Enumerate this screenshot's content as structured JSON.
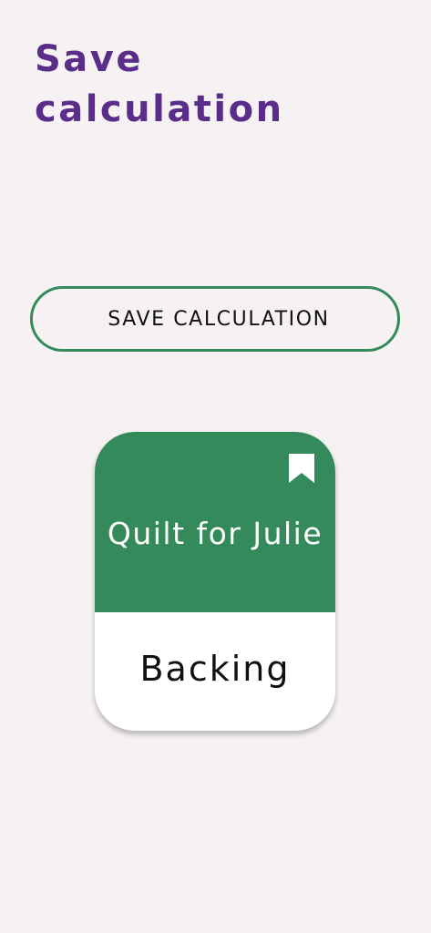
{
  "header": {
    "title": "Save calculation"
  },
  "actions": {
    "save_label": "SAVE CALCULATION"
  },
  "card": {
    "title": "Quilt for Julie",
    "subtitle": "Backing",
    "icon": "bookmark-icon"
  },
  "colors": {
    "background": "#f6f2f3",
    "title": "#5b2d8a",
    "accent_green": "#358a5b",
    "card_bottom": "#ffffff",
    "text_dark": "#111111"
  }
}
